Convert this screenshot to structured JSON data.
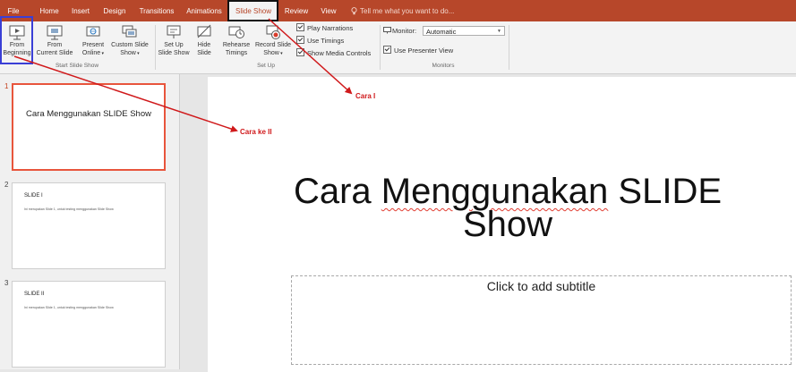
{
  "tabs": [
    {
      "label": "File",
      "active": false
    },
    {
      "label": "Home",
      "active": false
    },
    {
      "label": "Insert",
      "active": false
    },
    {
      "label": "Design",
      "active": false
    },
    {
      "label": "Transitions",
      "active": false
    },
    {
      "label": "Animations",
      "active": false
    },
    {
      "label": "Slide Show",
      "active": true
    },
    {
      "label": "Review",
      "active": false
    },
    {
      "label": "View",
      "active": false
    }
  ],
  "tell_me": {
    "icon": "lightbulb-icon",
    "text": "Tell me what you want to do..."
  },
  "ribbon": {
    "start_slide_show": {
      "label": "Start Slide Show",
      "from_beginning": {
        "line1": "From",
        "line2": "Beginning",
        "icon": "slideshow-from-beginning-icon"
      },
      "from_current": {
        "line1": "From",
        "line2": "Current Slide",
        "icon": "slideshow-from-current-icon"
      },
      "present_online": {
        "line1": "Present",
        "line2": "Online",
        "icon": "present-online-icon"
      },
      "custom_show": {
        "line1": "Custom Slide",
        "line2": "Show",
        "icon": "custom-slide-show-icon"
      }
    },
    "set_up": {
      "label": "Set Up",
      "set_up_show": {
        "line1": "Set Up",
        "line2": "Slide Show",
        "icon": "setup-slide-show-icon"
      },
      "hide_slide": {
        "line1": "Hide",
        "line2": "Slide",
        "icon": "hide-slide-icon"
      },
      "rehearse": {
        "line1": "Rehearse",
        "line2": "Timings",
        "icon": "rehearse-timings-icon"
      },
      "record": {
        "line1": "Record Slide",
        "line2": "Show",
        "icon": "record-slide-show-icon"
      },
      "play_narrations": {
        "label": "Play Narrations",
        "checked": true
      },
      "use_timings": {
        "label": "Use Timings",
        "checked": true
      },
      "show_media_controls": {
        "label": "Show Media Controls",
        "checked": true
      }
    },
    "monitors": {
      "label": "Monitors",
      "monitor_label": "Monitor:",
      "monitor_value": "Automatic",
      "use_presenter_view": {
        "label": "Use Presenter View",
        "checked": true
      }
    }
  },
  "slides": [
    {
      "number": "1",
      "title": "Cara Menggunakan SLIDE Show",
      "selected": true
    },
    {
      "number": "2",
      "heading": "SLIDE I",
      "body": "Ini merupakan Slide 1, untuk testing menggunakan Slide Show",
      "selected": false
    },
    {
      "number": "3",
      "heading": "SLIDE II",
      "body": "Ini merupakan Slide 1, untuk testing menggunakan Slide Show",
      "selected": false
    }
  ],
  "main_slide": {
    "title_line1_pre": "Cara ",
    "title_line1_spell": "Menggunakan",
    "title_line1_post": " SLIDE",
    "title_line2": "Show",
    "subtitle_placeholder": "Click to add subtitle"
  },
  "annotations": {
    "cara1": "Cara I",
    "cara2": "Cara ke II",
    "color": "#d0191b"
  },
  "colors": {
    "tab_bar": "#b7472a",
    "ribbon": "#f3f3f3",
    "selected_thumb_border": "#e8553c"
  }
}
